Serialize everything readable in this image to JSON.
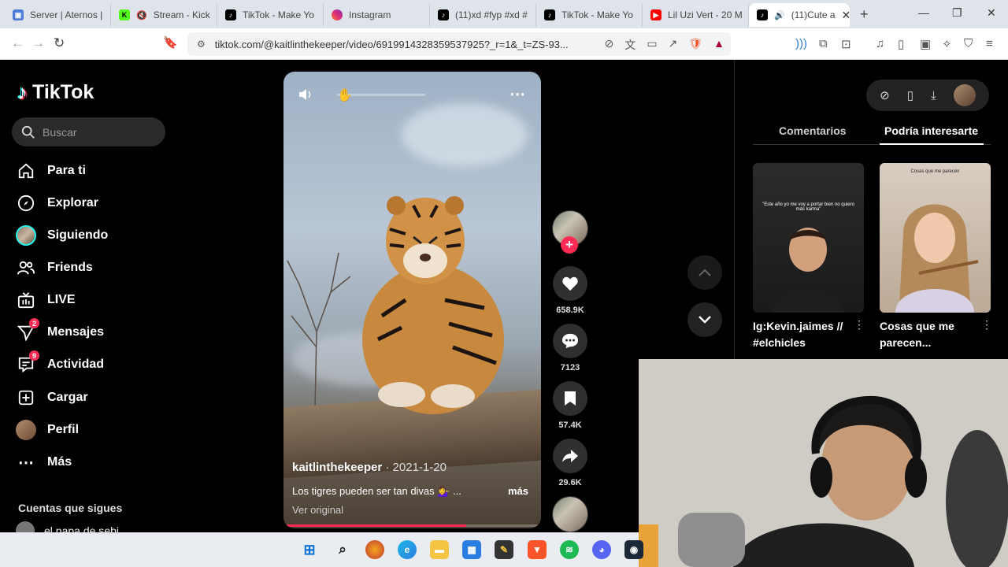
{
  "browser": {
    "tabs": [
      {
        "title": "Server | Aternos |",
        "icon": "aternos-icon",
        "color": "#4285f4"
      },
      {
        "title": "Stream - Kick",
        "icon": "kick-icon",
        "color": "#53fc18"
      },
      {
        "title": "TikTok - Make Yo",
        "icon": "tiktok-icon",
        "color": "#000000"
      },
      {
        "title": "Instagram",
        "icon": "instagram-icon",
        "color": "#e1306c"
      },
      {
        "title": "(11)xd #fyp #xd #",
        "icon": "tiktok-icon",
        "color": "#000000"
      },
      {
        "title": "TikTok - Make Yo",
        "icon": "tiktok-icon",
        "color": "#000000"
      },
      {
        "title": "Lil Uzi Vert - 20 M",
        "icon": "youtube-icon",
        "color": "#ff0000"
      },
      {
        "title": "(11)Cute a",
        "icon": "tiktok-icon",
        "color": "#000000",
        "active": true
      }
    ],
    "url": "tiktok.com/@kaitlinthekeeper/video/6919914328359537925?_r=1&_t=ZS-93..."
  },
  "sidebar": {
    "logo": "TikTok",
    "search_placeholder": "Buscar",
    "items": [
      {
        "label": "Para ti",
        "icon": "home-icon"
      },
      {
        "label": "Explorar",
        "icon": "compass-icon"
      },
      {
        "label": "Siguiendo",
        "icon": "avatar"
      },
      {
        "label": "Friends",
        "icon": "friends-icon"
      },
      {
        "label": "LIVE",
        "icon": "live-icon"
      },
      {
        "label": "Mensajes",
        "icon": "messages-icon",
        "badge": "2"
      },
      {
        "label": "Actividad",
        "icon": "activity-icon",
        "badge": "9"
      },
      {
        "label": "Cargar",
        "icon": "upload-icon"
      },
      {
        "label": "Perfil",
        "icon": "profile-avatar"
      },
      {
        "label": "Más",
        "icon": "more-icon"
      }
    ],
    "following_title": "Cuentas que sigues",
    "following": [
      {
        "name": "el papa de sebi"
      }
    ]
  },
  "video": {
    "author": "kaitlinthekeeper",
    "date": "· 2021-1-20",
    "caption": "Los tigres pueden ser tan divas 💁‍♀️ ...",
    "more": "más",
    "original": "Ver original",
    "progress": 0.71
  },
  "actions": {
    "likes": "658.9K",
    "comments": "7123",
    "saves": "57.4K",
    "shares": "29.6K"
  },
  "panel": {
    "tab_comments": "Comentarios",
    "tab_suggested": "Podría interesarte",
    "videos": [
      {
        "title": "Ig:Kevin.jaimes // #elchicles",
        "overlay": "\"Este año yo me voy a portar bien no quiero más karma\""
      },
      {
        "title": "Cosas que me parecen...",
        "overlay": "Cosas que me parecen"
      }
    ]
  },
  "colors": {
    "accent": "#fe2c55",
    "background": "#000000"
  }
}
